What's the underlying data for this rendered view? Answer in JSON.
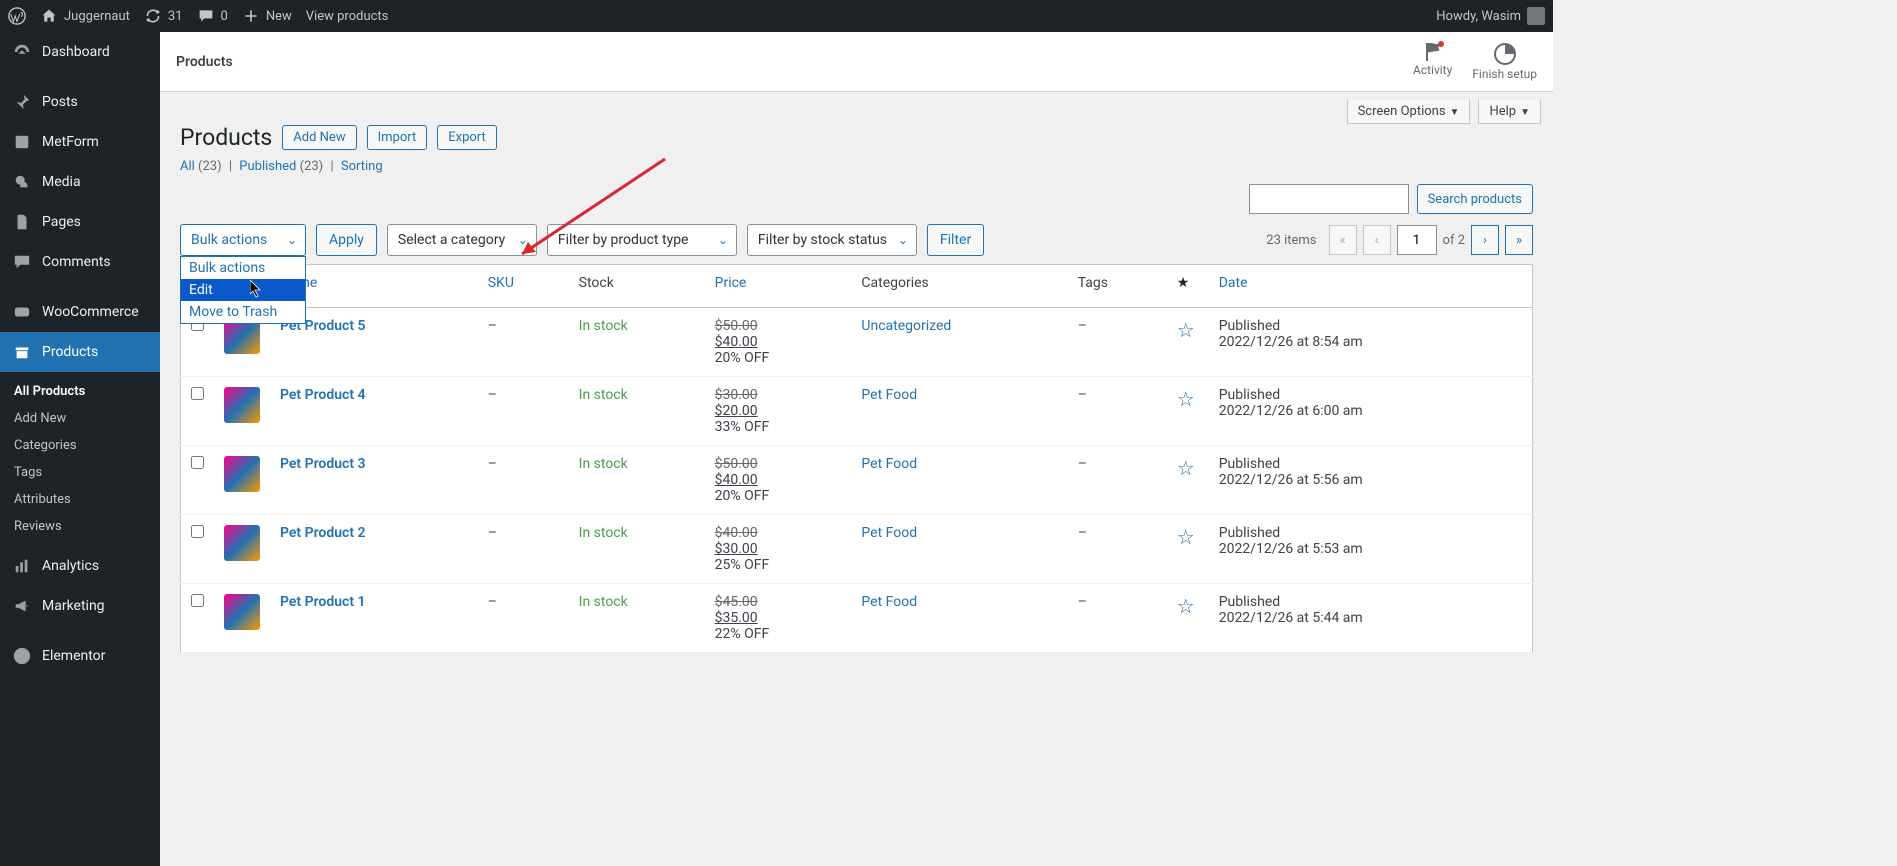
{
  "adminbar": {
    "site_name": "Juggernaut",
    "updates": "31",
    "comments": "0",
    "new": "New",
    "view_products": "View products",
    "howdy": "Howdy, Wasim"
  },
  "sidebar": {
    "items": [
      {
        "label": "Dashboard",
        "icon": "dashboard"
      },
      {
        "label": "Posts",
        "icon": "pin"
      },
      {
        "label": "MetForm",
        "icon": "metform"
      },
      {
        "label": "Media",
        "icon": "media"
      },
      {
        "label": "Pages",
        "icon": "pages"
      },
      {
        "label": "Comments",
        "icon": "comments"
      },
      {
        "label": "WooCommerce",
        "icon": "woo"
      },
      {
        "label": "Products",
        "icon": "products",
        "current": true
      },
      {
        "label": "Analytics",
        "icon": "analytics"
      },
      {
        "label": "Marketing",
        "icon": "marketing"
      },
      {
        "label": "Elementor",
        "icon": "elementor"
      }
    ],
    "submenu": [
      {
        "label": "All Products",
        "current": true
      },
      {
        "label": "Add New"
      },
      {
        "label": "Categories"
      },
      {
        "label": "Tags"
      },
      {
        "label": "Attributes"
      },
      {
        "label": "Reviews"
      }
    ]
  },
  "header": {
    "title": "Products",
    "activity": "Activity",
    "finish_setup": "Finish setup"
  },
  "tabs": {
    "screen_options": "Screen Options",
    "help": "Help"
  },
  "page": {
    "title": "Products",
    "add_new": "Add New",
    "import": "Import",
    "export": "Export"
  },
  "subsub": {
    "all": "All",
    "all_count": "(23)",
    "published": "Published",
    "published_count": "(23)",
    "sorting": "Sorting"
  },
  "filters": {
    "bulk": "Bulk actions",
    "apply": "Apply",
    "category": "Select a category",
    "product_type": "Filter by product type",
    "stock_status": "Filter by stock status",
    "filter": "Filter"
  },
  "dropdown": {
    "opt1": "Bulk actions",
    "opt2": "Edit",
    "opt3": "Move to Trash"
  },
  "search": {
    "button": "Search products"
  },
  "pagination": {
    "items": "23 items",
    "page": "1",
    "of": "of 2"
  },
  "columns": {
    "name": "Name",
    "sku": "SKU",
    "stock": "Stock",
    "price": "Price",
    "categories": "Categories",
    "tags": "Tags",
    "date": "Date"
  },
  "rows": [
    {
      "name": "Pet Product 5",
      "sku": "–",
      "stock": "In stock",
      "old": "$50.00",
      "new": "$40.00",
      "off": "20% OFF",
      "cat": "Uncategorized",
      "tags": "–",
      "pub": "Published",
      "date": "2022/12/26 at 8:54 am"
    },
    {
      "name": "Pet Product 4",
      "sku": "–",
      "stock": "In stock",
      "old": "$30.00",
      "new": "$20.00",
      "off": "33% OFF",
      "cat": "Pet Food",
      "tags": "–",
      "pub": "Published",
      "date": "2022/12/26 at 6:00 am"
    },
    {
      "name": "Pet Product 3",
      "sku": "–",
      "stock": "In stock",
      "old": "$50.00",
      "new": "$40.00",
      "off": "20% OFF",
      "cat": "Pet Food",
      "tags": "–",
      "pub": "Published",
      "date": "2022/12/26 at 5:56 am"
    },
    {
      "name": "Pet Product 2",
      "sku": "–",
      "stock": "In stock",
      "old": "$40.00",
      "new": "$30.00",
      "off": "25% OFF",
      "cat": "Pet Food",
      "tags": "–",
      "pub": "Published",
      "date": "2022/12/26 at 5:53 am"
    },
    {
      "name": "Pet Product 1",
      "sku": "–",
      "stock": "In stock",
      "old": "$45.00",
      "new": "$35.00",
      "off": "22% OFF",
      "cat": "Pet Food",
      "tags": "–",
      "pub": "Published",
      "date": "2022/12/26 at 5:44 am"
    }
  ]
}
